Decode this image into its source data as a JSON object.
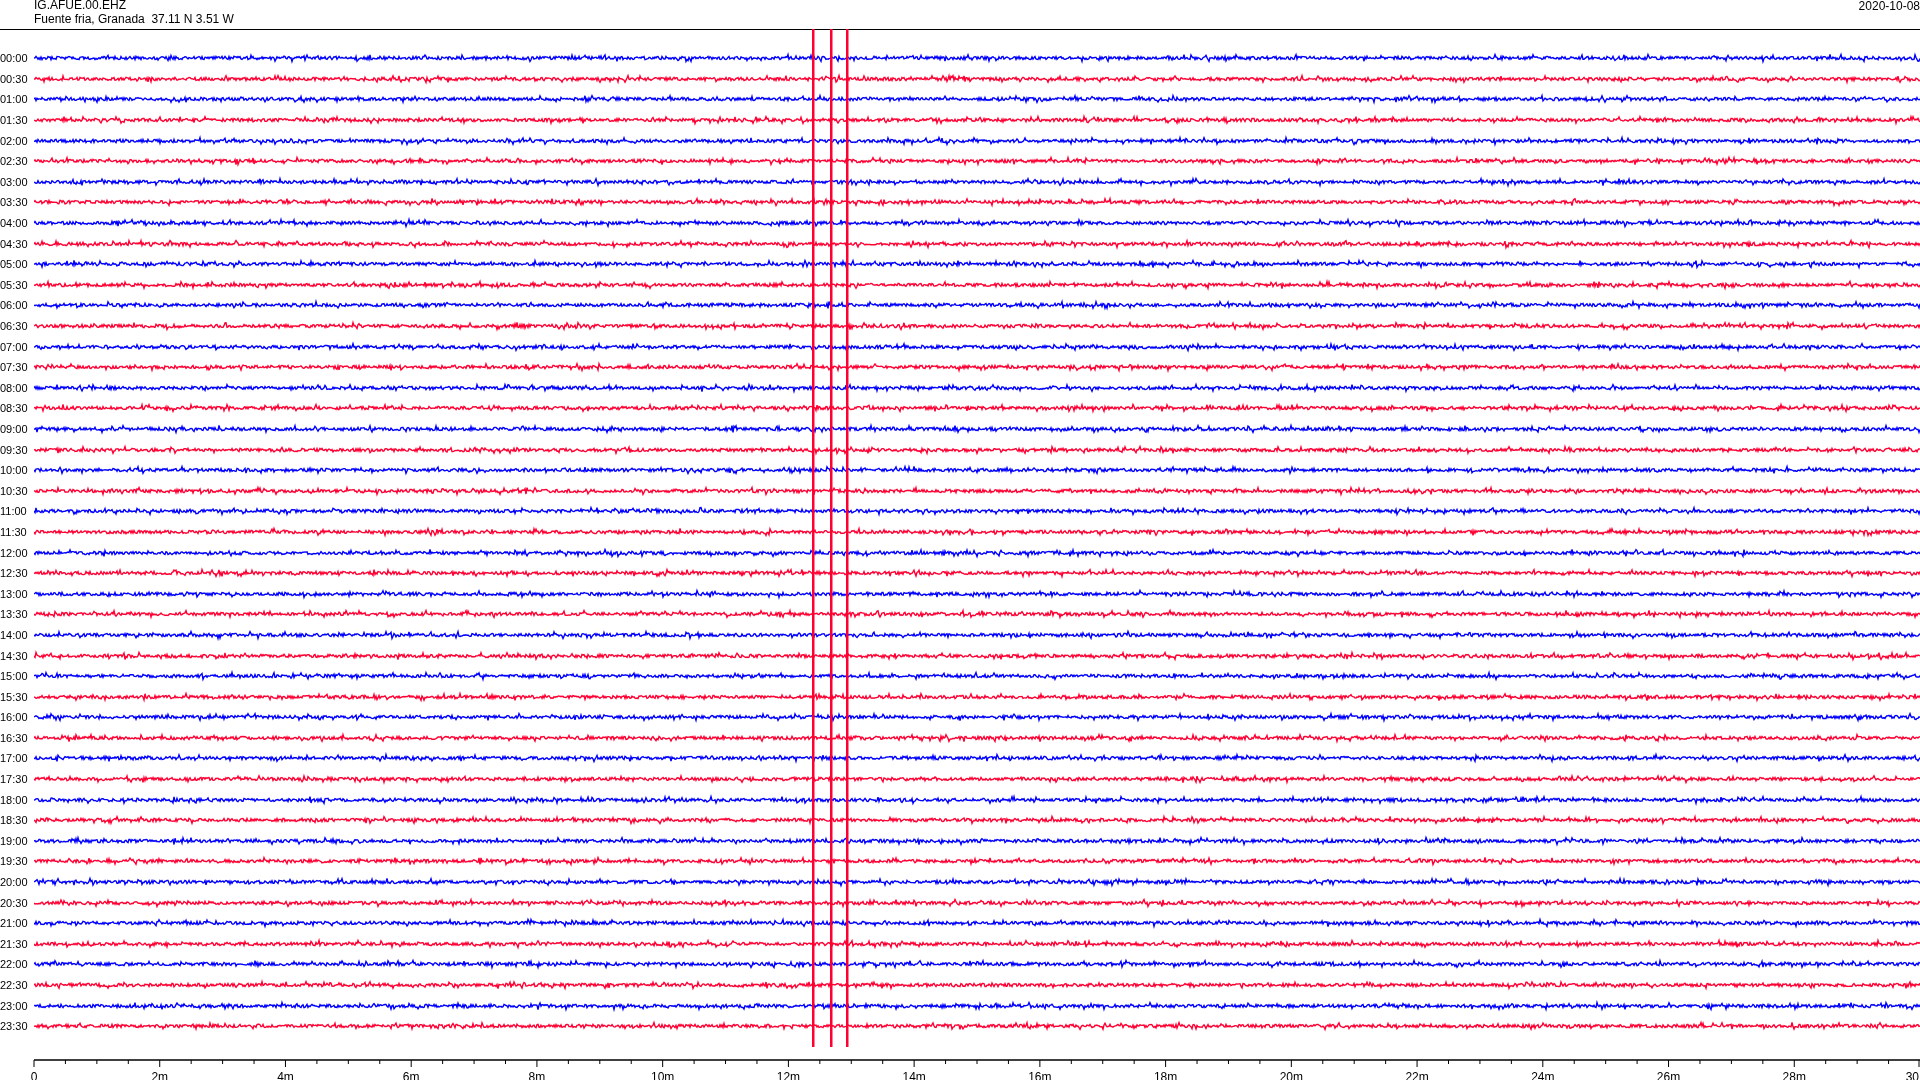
{
  "header": {
    "station": "IG.AFUE.00.EHZ",
    "location": "Fuente fria, Granada  37.11 N 3.51 W",
    "date": "2020-10-08"
  },
  "rows": [
    {
      "label": "00:00",
      "color": "#0000ff"
    },
    {
      "label": "00:30",
      "color": "#ff0033"
    },
    {
      "label": "01:00",
      "color": "#0000ff"
    },
    {
      "label": "01:30",
      "color": "#ff0033"
    },
    {
      "label": "02:00",
      "color": "#0000ff"
    },
    {
      "label": "02:30",
      "color": "#ff0033"
    },
    {
      "label": "03:00",
      "color": "#0000ff"
    },
    {
      "label": "03:30",
      "color": "#ff0033"
    },
    {
      "label": "04:00",
      "color": "#0000ff"
    },
    {
      "label": "04:30",
      "color": "#ff0033"
    },
    {
      "label": "05:00",
      "color": "#0000ff"
    },
    {
      "label": "05:30",
      "color": "#ff0033"
    },
    {
      "label": "06:00",
      "color": "#0000ff"
    },
    {
      "label": "06:30",
      "color": "#ff0033"
    },
    {
      "label": "07:00",
      "color": "#0000ff"
    },
    {
      "label": "07:30",
      "color": "#ff0033"
    },
    {
      "label": "08:00",
      "color": "#0000ff"
    },
    {
      "label": "08:30",
      "color": "#ff0033"
    },
    {
      "label": "09:00",
      "color": "#0000ff"
    },
    {
      "label": "09:30",
      "color": "#ff0033"
    },
    {
      "label": "10:00",
      "color": "#0000ff"
    },
    {
      "label": "10:30",
      "color": "#ff0033"
    },
    {
      "label": "11:00",
      "color": "#0000ff"
    },
    {
      "label": "11:30",
      "color": "#ff0033"
    },
    {
      "label": "12:00",
      "color": "#0000ff"
    },
    {
      "label": "12:30",
      "color": "#ff0033"
    },
    {
      "label": "13:00",
      "color": "#0000ff"
    },
    {
      "label": "13:30",
      "color": "#ff0033"
    },
    {
      "label": "14:00",
      "color": "#0000ff"
    },
    {
      "label": "14:30",
      "color": "#ff0033"
    },
    {
      "label": "15:00",
      "color": "#0000ff"
    },
    {
      "label": "15:30",
      "color": "#ff0033"
    },
    {
      "label": "16:00",
      "color": "#0000ff"
    },
    {
      "label": "16:30",
      "color": "#ff0033"
    },
    {
      "label": "17:00",
      "color": "#0000ff"
    },
    {
      "label": "17:30",
      "color": "#ff0033"
    },
    {
      "label": "18:00",
      "color": "#0000ff"
    },
    {
      "label": "18:30",
      "color": "#ff0033"
    },
    {
      "label": "19:00",
      "color": "#0000ff"
    },
    {
      "label": "19:30",
      "color": "#ff0033"
    },
    {
      "label": "20:00",
      "color": "#0000ff"
    },
    {
      "label": "20:30",
      "color": "#ff0033"
    },
    {
      "label": "21:00",
      "color": "#0000ff"
    },
    {
      "label": "21:30",
      "color": "#ff0033"
    },
    {
      "label": "22:00",
      "color": "#0000ff"
    },
    {
      "label": "22:30",
      "color": "#ff0033"
    },
    {
      "label": "23:00",
      "color": "#0000ff"
    },
    {
      "label": "23:30",
      "color": "#ff0033"
    }
  ],
  "x_axis": {
    "ticks": [
      "0",
      "2m",
      "4m",
      "6m",
      "8m",
      "10m",
      "12m",
      "14m",
      "16m",
      "18m",
      "20m",
      "22m",
      "24m",
      "26m",
      "28m",
      "30"
    ]
  }
}
